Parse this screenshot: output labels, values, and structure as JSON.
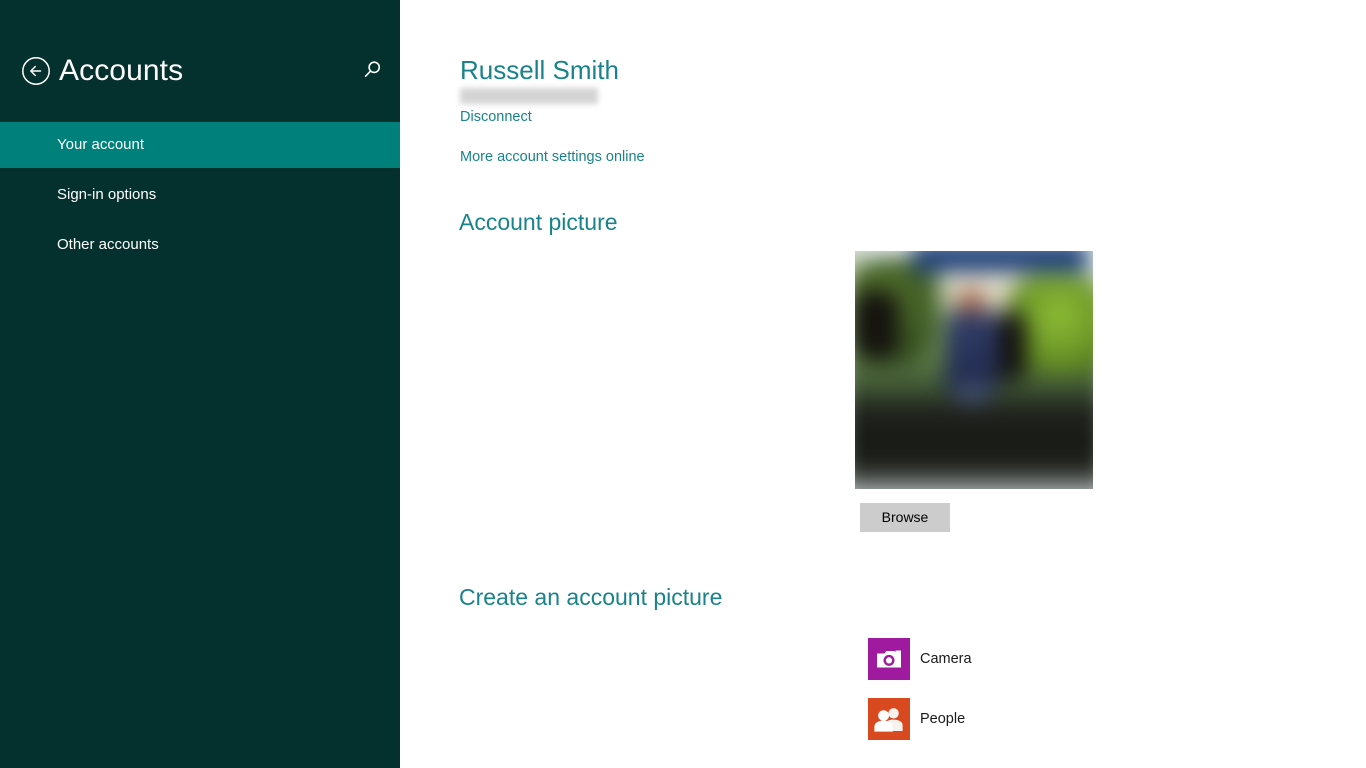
{
  "sidebar": {
    "title": "Accounts",
    "back_icon": "back-arrow-icon",
    "search_icon": "search-icon",
    "items": [
      {
        "label": "Your account",
        "selected": true
      },
      {
        "label": "Sign-in options",
        "selected": false
      },
      {
        "label": "Other accounts",
        "selected": false
      }
    ]
  },
  "content": {
    "account": {
      "name": "Russell Smith",
      "email_redacted": true,
      "disconnect_label": "Disconnect",
      "more_settings_label": "More account settings online"
    },
    "account_picture": {
      "heading": "Account picture",
      "browse_label": "Browse",
      "image_description": "blurred photo of a person outdoors"
    },
    "create_picture": {
      "heading": "Create an account picture",
      "apps": [
        {
          "label": "Camera",
          "icon": "camera-icon",
          "tile_color": "#a01aa0"
        },
        {
          "label": "People",
          "icon": "people-icon",
          "tile_color": "#d8491f"
        }
      ]
    }
  },
  "colors": {
    "sidebar_bg": "#04312d",
    "sidebar_selected": "#00807a",
    "accent_teal": "#18838a",
    "content_bg": "#ffffff",
    "button_bg": "#cccccc"
  }
}
